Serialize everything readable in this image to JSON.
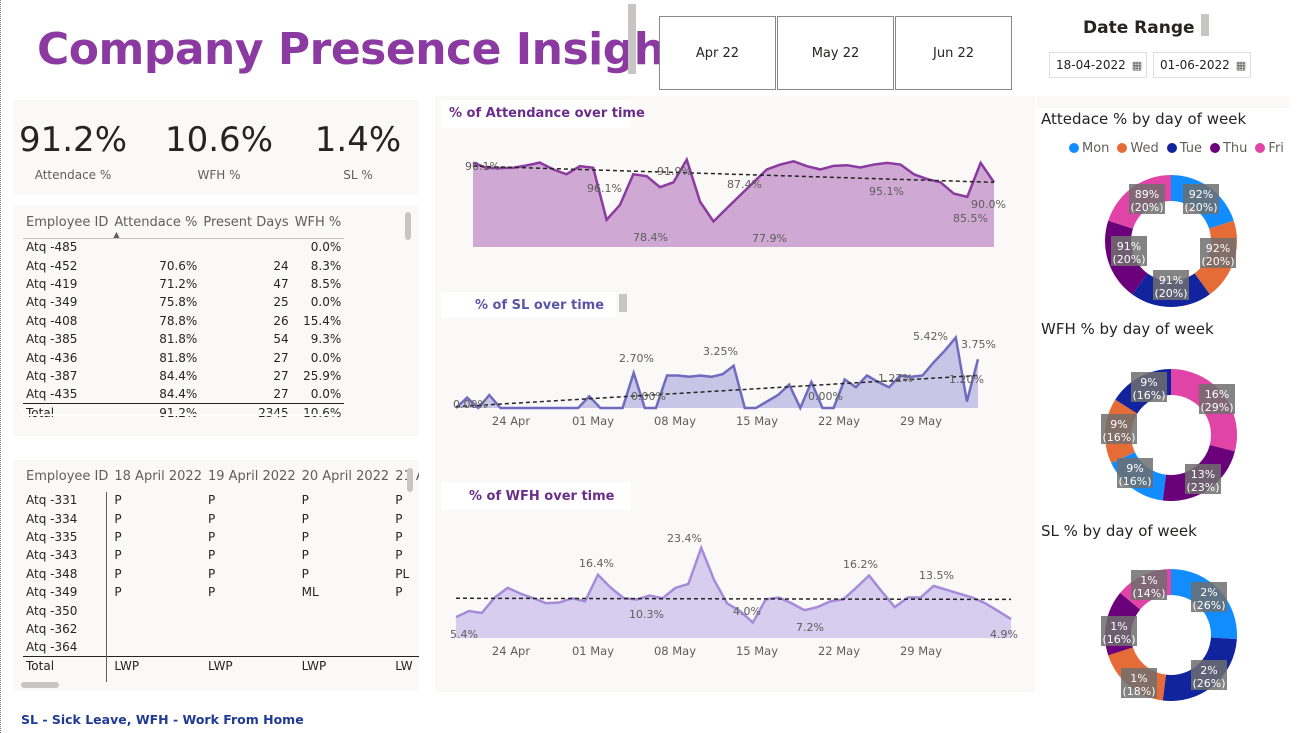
{
  "title": "Company Presence Insights",
  "months": [
    "Apr 22",
    "May 22",
    "Jun 22"
  ],
  "date_range": {
    "label": "Date Range",
    "start": "18-04-2022",
    "end": "01-06-2022"
  },
  "kpis": [
    {
      "value": "91.2%",
      "label": "Attendace %"
    },
    {
      "value": "10.6%",
      "label": "WFH %"
    },
    {
      "value": "1.4%",
      "label": "SL %"
    }
  ],
  "employee_table": {
    "columns": [
      "Employee ID",
      "Attendace %",
      "Present Days",
      "WFH %"
    ],
    "rows": [
      [
        "Atq -485",
        "",
        "",
        "0.0%"
      ],
      [
        "Atq -452",
        "70.6%",
        "24",
        "8.3%"
      ],
      [
        "Atq -419",
        "71.2%",
        "47",
        "8.5%"
      ],
      [
        "Atq -349",
        "75.8%",
        "25",
        "0.0%"
      ],
      [
        "Atq -408",
        "78.8%",
        "26",
        "15.4%"
      ],
      [
        "Atq -385",
        "81.8%",
        "54",
        "9.3%"
      ],
      [
        "Atq -436",
        "81.8%",
        "27",
        "0.0%"
      ],
      [
        "Atq -387",
        "84.4%",
        "27",
        "25.9%"
      ],
      [
        "Atq -435",
        "84.4%",
        "27",
        "0.0%"
      ]
    ],
    "total": [
      "Total",
      "91.2%",
      "2345",
      "10.6%"
    ]
  },
  "daily_table": {
    "columns": [
      "Employee ID",
      "18 April 2022",
      "19 April 2022",
      "20 April 2022",
      "21 A"
    ],
    "rows": [
      [
        "Atq -331",
        "P",
        "P",
        "P",
        "P"
      ],
      [
        "Atq -334",
        "P",
        "P",
        "P",
        "P"
      ],
      [
        "Atq -335",
        "P",
        "P",
        "P",
        "P"
      ],
      [
        "Atq -343",
        "P",
        "P",
        "P",
        "P"
      ],
      [
        "Atq -348",
        "P",
        "P",
        "P",
        "PL"
      ],
      [
        "Atq -349",
        "P",
        "P",
        "ML",
        "P"
      ],
      [
        "Atq -350",
        "",
        "",
        "",
        ""
      ],
      [
        "Atq -362",
        "",
        "",
        "",
        ""
      ],
      [
        "Atq -364",
        "",
        "",
        "",
        ""
      ]
    ],
    "total": [
      "Total",
      "LWP",
      "LWP",
      "LWP",
      "LW"
    ]
  },
  "chart_titles": {
    "attendance": "% of Attendance over time",
    "sl": "% of SL over time",
    "wfh": "% of WFH over time",
    "donut_att": "Attedace % by day of week",
    "donut_wfh": "WFH % by day of week",
    "donut_sl": "SL % by day of week"
  },
  "legend": [
    {
      "name": "Mon",
      "color": "#118dff"
    },
    {
      "name": "Wed",
      "color": "#e66c37"
    },
    {
      "name": "Tue",
      "color": "#12239e"
    },
    {
      "name": "Thu",
      "color": "#6b007b"
    },
    {
      "name": "Fri",
      "color": "#e044a7"
    }
  ],
  "footer": "SL - Sick Leave, WFH - Work From Home",
  "chart_data": [
    {
      "type": "area",
      "name": "attendance",
      "color": "#8a3aa0",
      "fill": "#cfa8d4",
      "ylim": [
        70,
        100
      ],
      "x_ticks": [],
      "y": [
        96.1,
        94.5,
        94.4,
        94.5,
        95.2,
        96.1,
        94.0,
        92.5,
        95.0,
        94.5,
        78.4,
        83.0,
        92.5,
        91.9,
        88.5,
        90.0,
        97.0,
        84.0,
        77.9,
        82.0,
        86.0,
        90.0,
        94.0,
        95.5,
        96.5,
        95.0,
        94.0,
        95.1,
        95.3,
        94.6,
        95.5,
        96.0,
        95.5,
        92.5,
        91.0,
        90.0,
        86.5,
        85.5,
        96.0,
        90.0
      ],
      "labels": [
        "96.1%",
        "96.1%",
        "91.9%",
        "87.4%",
        "78.4%",
        "77.9%",
        "95.1%",
        "90.0%",
        "85.5%"
      ],
      "trend": [
        95.0,
        90.0
      ]
    },
    {
      "type": "area",
      "name": "sl",
      "color": "#6f6bbf",
      "fill": "#c8c6e6",
      "ylim": [
        0,
        6
      ],
      "x_ticks": [
        "24 Apr",
        "01 May",
        "08 May",
        "15 May",
        "22 May",
        "29 May"
      ],
      "y": [
        0.0,
        0.8,
        0.0,
        1.0,
        0.0,
        0.0,
        0.0,
        0.0,
        0.0,
        0.0,
        0.0,
        0.0,
        0.9,
        0.0,
        0.0,
        0.0,
        2.7,
        0.0,
        0.0,
        2.5,
        2.5,
        2.4,
        2.5,
        2.4,
        2.6,
        3.25,
        0.0,
        0.0,
        0.5,
        1.0,
        1.8,
        0.0,
        2.0,
        0.0,
        0.0,
        2.2,
        1.6,
        2.5,
        2.0,
        1.6,
        2.5,
        2.4,
        2.5,
        3.5,
        4.4,
        5.42,
        0.5,
        3.75
      ],
      "labels": [
        "0.00%",
        "2.70%",
        "0.00%",
        "3.25%",
        "0.00%",
        "1.22%",
        "5.42%",
        "3.75%",
        "1.20%"
      ],
      "trend": [
        0.1,
        2.5
      ]
    },
    {
      "type": "area",
      "name": "wfh",
      "color": "#a78ad8",
      "fill": "#d7cdee",
      "ylim": [
        0,
        28
      ],
      "x_ticks": [
        "24 Apr",
        "01 May",
        "08 May",
        "15 May",
        "22 May",
        "29 May"
      ],
      "y": [
        5.4,
        7.0,
        6.5,
        10.5,
        13.0,
        11.5,
        10.3,
        9.0,
        9.2,
        10.3,
        9.5,
        16.4,
        13.0,
        10.3,
        10.0,
        11.0,
        10.3,
        13.0,
        14.0,
        23.4,
        15.0,
        9.0,
        7.0,
        4.0,
        10.0,
        10.5,
        9.0,
        7.2,
        8.0,
        9.5,
        10.0,
        13.0,
        16.2,
        12.0,
        8.0,
        10.5,
        10.5,
        13.5,
        12.5,
        11.5,
        10.5,
        9.0,
        7.0,
        4.9
      ],
      "labels": [
        "5.4%",
        "16.4%",
        "10.3%",
        "23.4%",
        "4.0%",
        "7.2%",
        "16.2%",
        "13.5%",
        "4.9%"
      ],
      "trend": [
        10.3,
        10.0
      ]
    },
    {
      "type": "pie",
      "name": "attendance-by-day",
      "categories": [
        "Mon",
        "Wed",
        "Tue",
        "Thu",
        "Fri"
      ],
      "values": [
        20,
        20,
        20,
        20,
        20
      ],
      "labels": [
        "92%\n(20%)",
        "92%\n(20%)",
        "91%\n(20%)",
        "91%\n(20%)",
        "89%\n(20%)"
      ]
    },
    {
      "type": "pie",
      "name": "wfh-by-day",
      "categories": [
        "Fri",
        "Thu",
        "Mon",
        "Wed",
        "Tue"
      ],
      "values": [
        29,
        23,
        16,
        16,
        16
      ],
      "labels": [
        "16%\n(29%)",
        "13%\n(23%)",
        "9%\n(16%)",
        "9%\n(16%)",
        "9%\n(16%)"
      ]
    },
    {
      "type": "pie",
      "name": "sl-by-day",
      "categories": [
        "Mon",
        "Tue",
        "Wed",
        "Thu",
        "Fri"
      ],
      "values": [
        26,
        26,
        18,
        16,
        14
      ],
      "labels": [
        "2%\n(26%)",
        "2%\n(26%)",
        "1%\n(18%)",
        "1%\n(16%)",
        "1%\n(14%)"
      ]
    }
  ]
}
